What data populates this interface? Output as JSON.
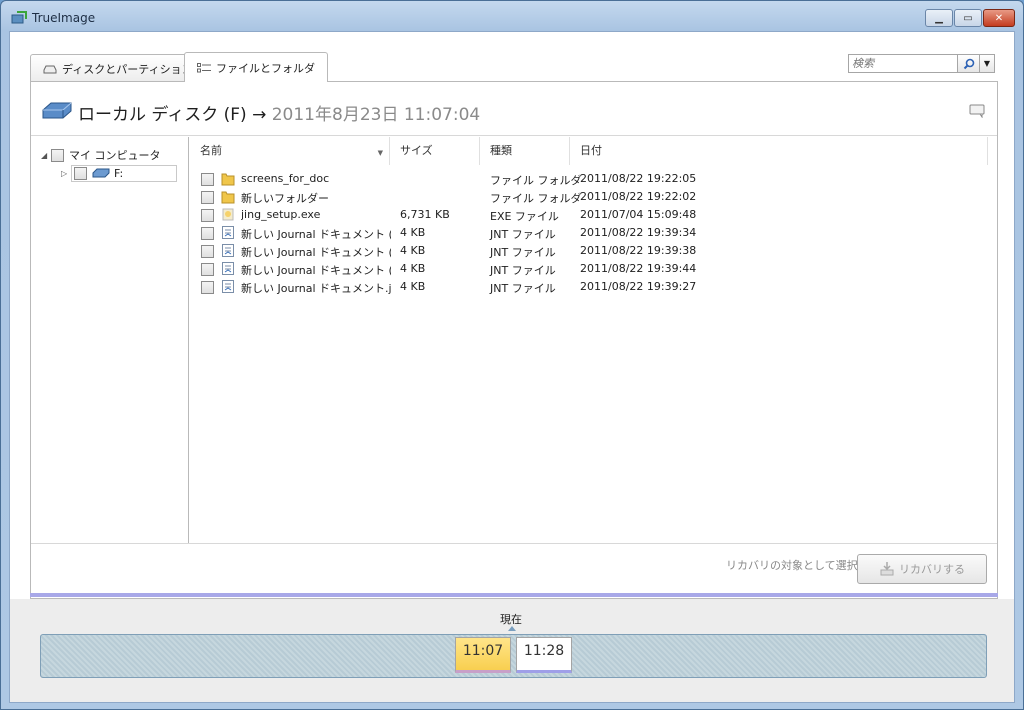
{
  "window": {
    "title": "TrueImage"
  },
  "tabs": [
    {
      "label": "ディスクとパーティション",
      "active": false
    },
    {
      "label": "ファイルとフォルダ",
      "active": true
    }
  ],
  "search": {
    "placeholder": "検索"
  },
  "header": {
    "disk": "ローカル ディスク (F)",
    "arrow": "→",
    "date": "2011年8月23日 11:07:04"
  },
  "tree": {
    "root": "マイ コンピュータ",
    "child": "F:"
  },
  "columns": {
    "name": "名前",
    "size": "サイズ",
    "type": "種類",
    "date": "日付"
  },
  "files": [
    {
      "name": "screens_for_doc",
      "size": "",
      "type": "ファイル フォルダ",
      "date": "2011/08/22 19:22:05",
      "icon": "folder-icon"
    },
    {
      "name": "新しいフォルダー",
      "size": "",
      "type": "ファイル フォルダ",
      "date": "2011/08/22 19:22:02",
      "icon": "folder-icon"
    },
    {
      "name": "jing_setup.exe",
      "size": "6,731 KB",
      "type": "EXE ファイル",
      "date": "2011/07/04 15:09:48",
      "icon": "exe-icon"
    },
    {
      "name": "新しい Journal ドキュメント (...",
      "size": "4 KB",
      "type": "JNT ファイル",
      "date": "2011/08/22 19:39:34",
      "icon": "journal-icon"
    },
    {
      "name": "新しい Journal ドキュメント (...",
      "size": "4 KB",
      "type": "JNT ファイル",
      "date": "2011/08/22 19:39:38",
      "icon": "journal-icon"
    },
    {
      "name": "新しい Journal ドキュメント (...",
      "size": "4 KB",
      "type": "JNT ファイル",
      "date": "2011/08/22 19:39:44",
      "icon": "journal-icon"
    },
    {
      "name": "新しい Journal ドキュメント.jnt",
      "size": "4 KB",
      "type": "JNT ファイル",
      "date": "2011/08/22 19:39:27",
      "icon": "journal-icon"
    }
  ],
  "footer": {
    "select_label": "リカバリの対象として選択:",
    "recover_button": "リカバリする"
  },
  "timeline": {
    "now_label": "現在",
    "slots": [
      "11:07",
      "11:28"
    ]
  },
  "colors": {
    "accent_timeline_selected": "#f8cf4f",
    "panel_bottom_line": "#a8a8e8"
  }
}
